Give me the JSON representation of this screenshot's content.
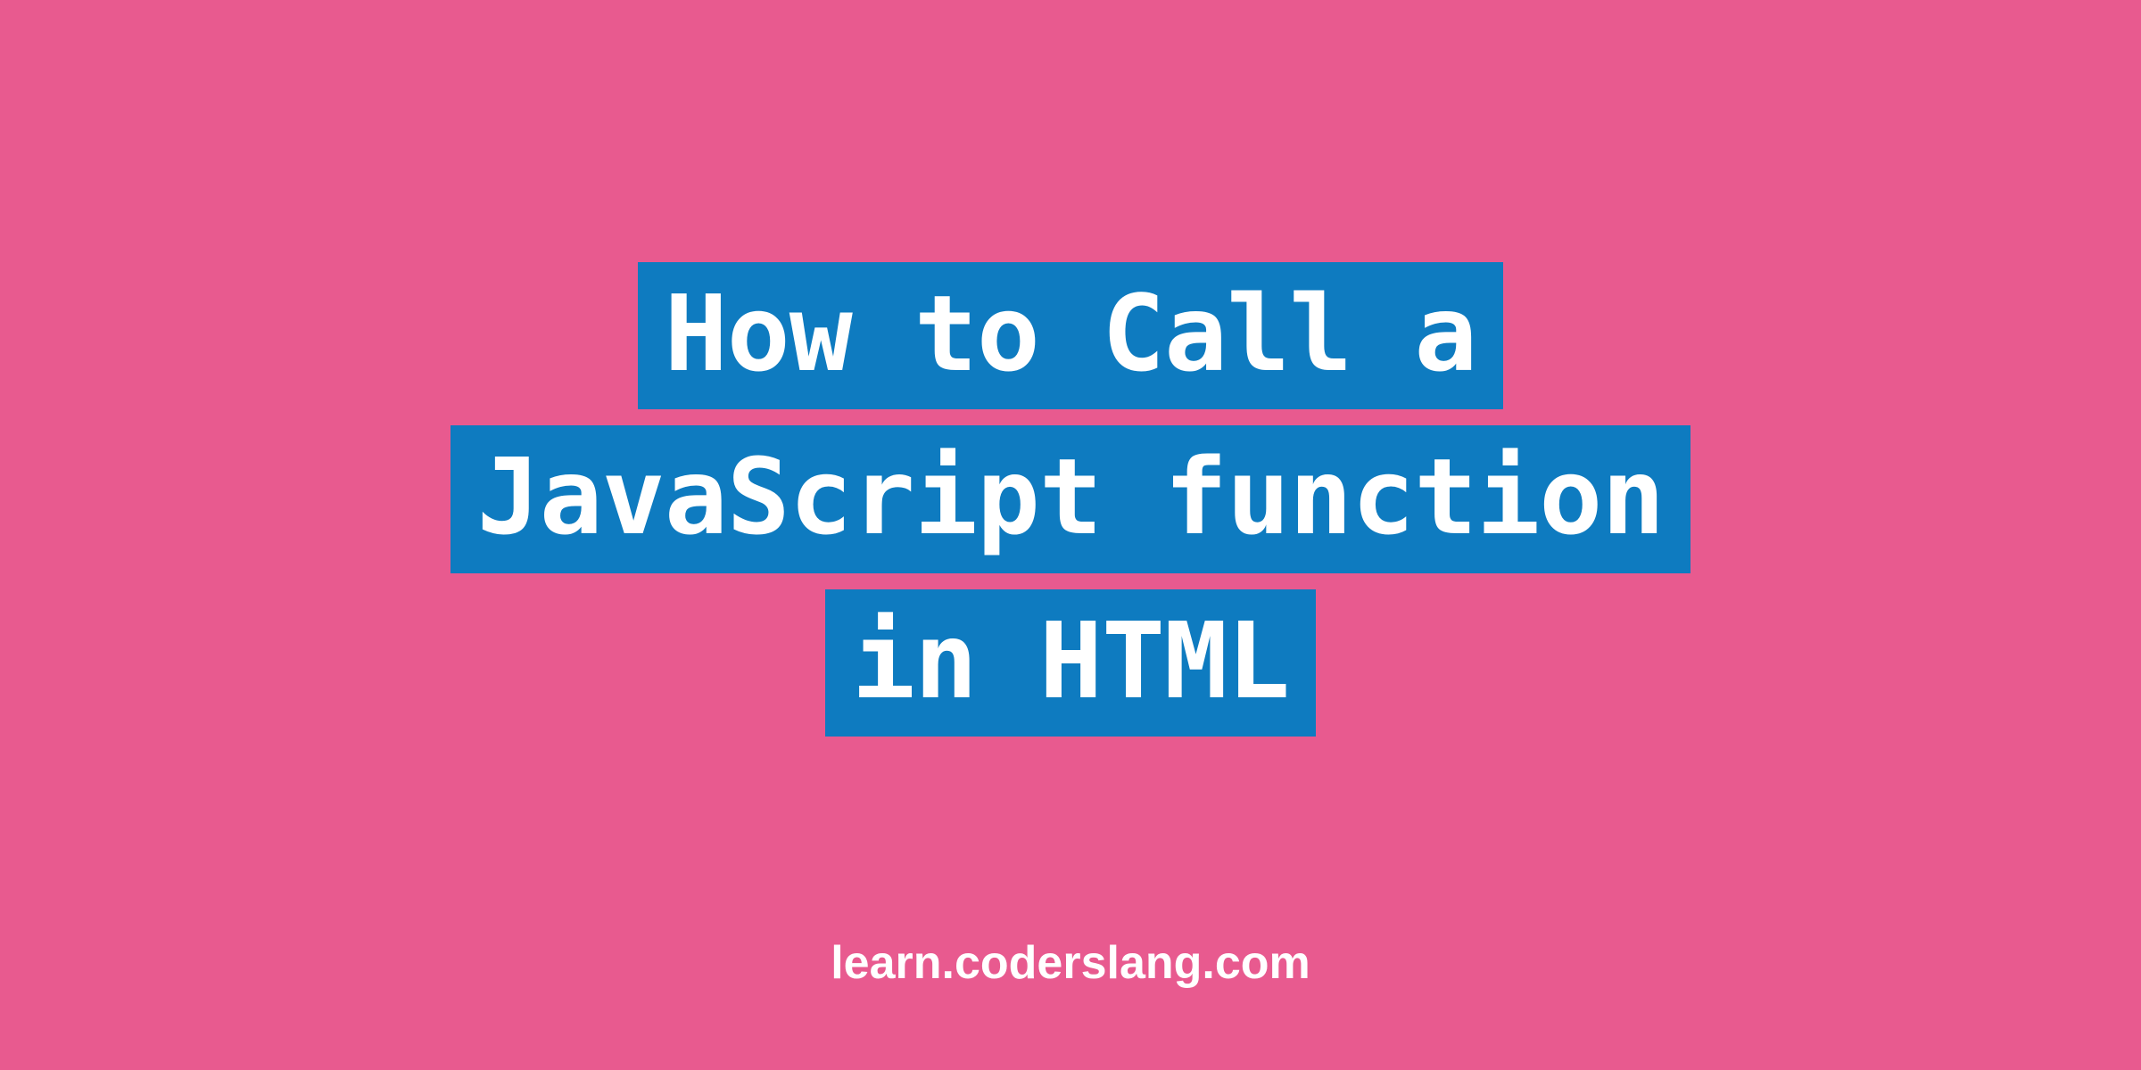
{
  "title": {
    "line1": "How to Call a",
    "line2": "JavaScript function",
    "line3": "in HTML"
  },
  "footer": {
    "text": "learn.coderslang.com"
  },
  "colors": {
    "background": "#e85a8f",
    "highlight": "#0e7bc0",
    "text": "#ffffff"
  }
}
